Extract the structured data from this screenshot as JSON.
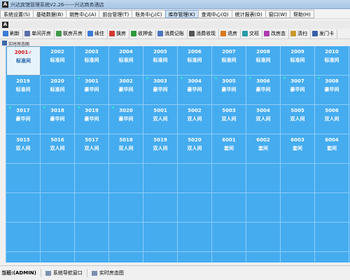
{
  "window": {
    "app_icon": "A",
    "title": "兴达宾馆管理系统V2.26------兴达商务酒店"
  },
  "menu": [
    {
      "label": "系统设置(S)",
      "active": false
    },
    {
      "label": "基础数据(B)",
      "active": false
    },
    {
      "label": "销售中心(A)",
      "active": false
    },
    {
      "label": "前台管理(T)",
      "active": false
    },
    {
      "label": "账务中心(C)",
      "active": false
    },
    {
      "label": "库存管理(K)",
      "active": true
    },
    {
      "label": "查询中心(Q)",
      "active": false
    },
    {
      "label": "统计报表(O)",
      "active": false
    },
    {
      "label": "窗口(W)",
      "active": false
    },
    {
      "label": "帮助(H)",
      "active": false
    }
  ],
  "header_icon": "A",
  "toolbar": [
    {
      "label": "刷新",
      "icon": "refresh-icon",
      "color": "#3b7bd6"
    },
    {
      "label": "单间开房",
      "icon": "door-icon",
      "color": "#5b6fa8"
    },
    {
      "label": "联房开房",
      "icon": "people-icon",
      "color": "#3e9a4a"
    },
    {
      "label": "续住",
      "icon": "calendar-icon",
      "color": "#3b7bd6"
    },
    {
      "label": "换房",
      "icon": "swap-icon",
      "color": "#d23a2e"
    },
    {
      "label": "收押金",
      "icon": "money-icon",
      "color": "#2f9a3a"
    },
    {
      "label": "消费记账",
      "icon": "note-icon",
      "color": "#4a76c0"
    },
    {
      "label": "消费收现",
      "icon": "cash-icon",
      "color": "#555555"
    },
    {
      "label": "退房",
      "icon": "exit-icon",
      "color": "#d87a1e"
    },
    {
      "label": "交班",
      "icon": "handover-icon",
      "color": "#2a9aa8"
    },
    {
      "label": "改房态",
      "icon": "edit-icon",
      "color": "#b03ab0"
    },
    {
      "label": "清扫",
      "icon": "broom-icon",
      "color": "#c99a2a"
    },
    {
      "label": "发门卡",
      "icon": "card-icon",
      "color": "#3a5fa8"
    }
  ],
  "panel_title": "实时房态图",
  "room_rows": [
    [
      {
        "num": "2001",
        "type": "标准间",
        "dot": false,
        "selected": true,
        "check": "✓"
      },
      {
        "num": "2002",
        "type": "标准间",
        "dot": false
      },
      {
        "num": "2003",
        "type": "标准间",
        "dot": false
      },
      {
        "num": "2004",
        "type": "标准间",
        "dot": false
      },
      {
        "num": "2005",
        "type": "标准间",
        "dot": false
      },
      {
        "num": "2006",
        "type": "标准间",
        "dot": false
      },
      {
        "num": "2007",
        "type": "标准间",
        "dot": false
      },
      {
        "num": "2008",
        "type": "标准间",
        "dot": false
      },
      {
        "num": "2009",
        "type": "标准间",
        "dot": false
      },
      {
        "num": "2010",
        "type": "标准间",
        "dot": false
      }
    ],
    [
      {
        "num": "2019",
        "type": "标准间",
        "dot": false
      },
      {
        "num": "2020",
        "type": "标准间",
        "dot": false
      },
      {
        "num": "3001",
        "type": "豪华间",
        "dot": true
      },
      {
        "num": "3002",
        "type": "豪华间",
        "dot": false
      },
      {
        "num": "3003",
        "type": "豪华间",
        "dot": true
      },
      {
        "num": "3004",
        "type": "豪华间",
        "dot": true
      },
      {
        "num": "3005",
        "type": "豪华间",
        "dot": true
      },
      {
        "num": "3006",
        "type": "豪华间",
        "dot": true
      },
      {
        "num": "3007",
        "type": "豪华间",
        "dot": true
      },
      {
        "num": "3008",
        "type": "豪华间",
        "dot": true
      }
    ],
    [
      {
        "num": "3017",
        "type": "豪华间",
        "dot": true
      },
      {
        "num": "3018",
        "type": "豪华间",
        "dot": true
      },
      {
        "num": "3019",
        "type": "豪华间",
        "dot": true
      },
      {
        "num": "3020",
        "type": "豪华间",
        "dot": true
      },
      {
        "num": "5001",
        "type": "双人间",
        "dot": false
      },
      {
        "num": "5002",
        "type": "双人间",
        "dot": false
      },
      {
        "num": "5003",
        "type": "双人间",
        "dot": false
      },
      {
        "num": "5004",
        "type": "双人间",
        "dot": false
      },
      {
        "num": "5005",
        "type": "双人间",
        "dot": false
      },
      {
        "num": "5006",
        "type": "双人间",
        "dot": false
      }
    ],
    [
      {
        "num": "5015",
        "type": "双人间",
        "dot": false
      },
      {
        "num": "5016",
        "type": "双人间",
        "dot": false
      },
      {
        "num": "5017",
        "type": "双人间",
        "dot": false
      },
      {
        "num": "5018",
        "type": "双人间",
        "dot": false
      },
      {
        "num": "5019",
        "type": "双人间",
        "dot": false
      },
      {
        "num": "5020",
        "type": "双人间",
        "dot": false
      },
      {
        "num": "6001",
        "type": "套间",
        "dot": false
      },
      {
        "num": "6002",
        "type": "套间",
        "dot": false
      },
      {
        "num": "6003",
        "type": "套间",
        "dot": false
      },
      {
        "num": "6004",
        "type": "套间",
        "dot": false
      }
    ]
  ],
  "status": {
    "user": "当班:(ADMIN)",
    "buttons": [
      {
        "label": "系统导航窗口"
      },
      {
        "label": "实时房态图"
      }
    ]
  }
}
